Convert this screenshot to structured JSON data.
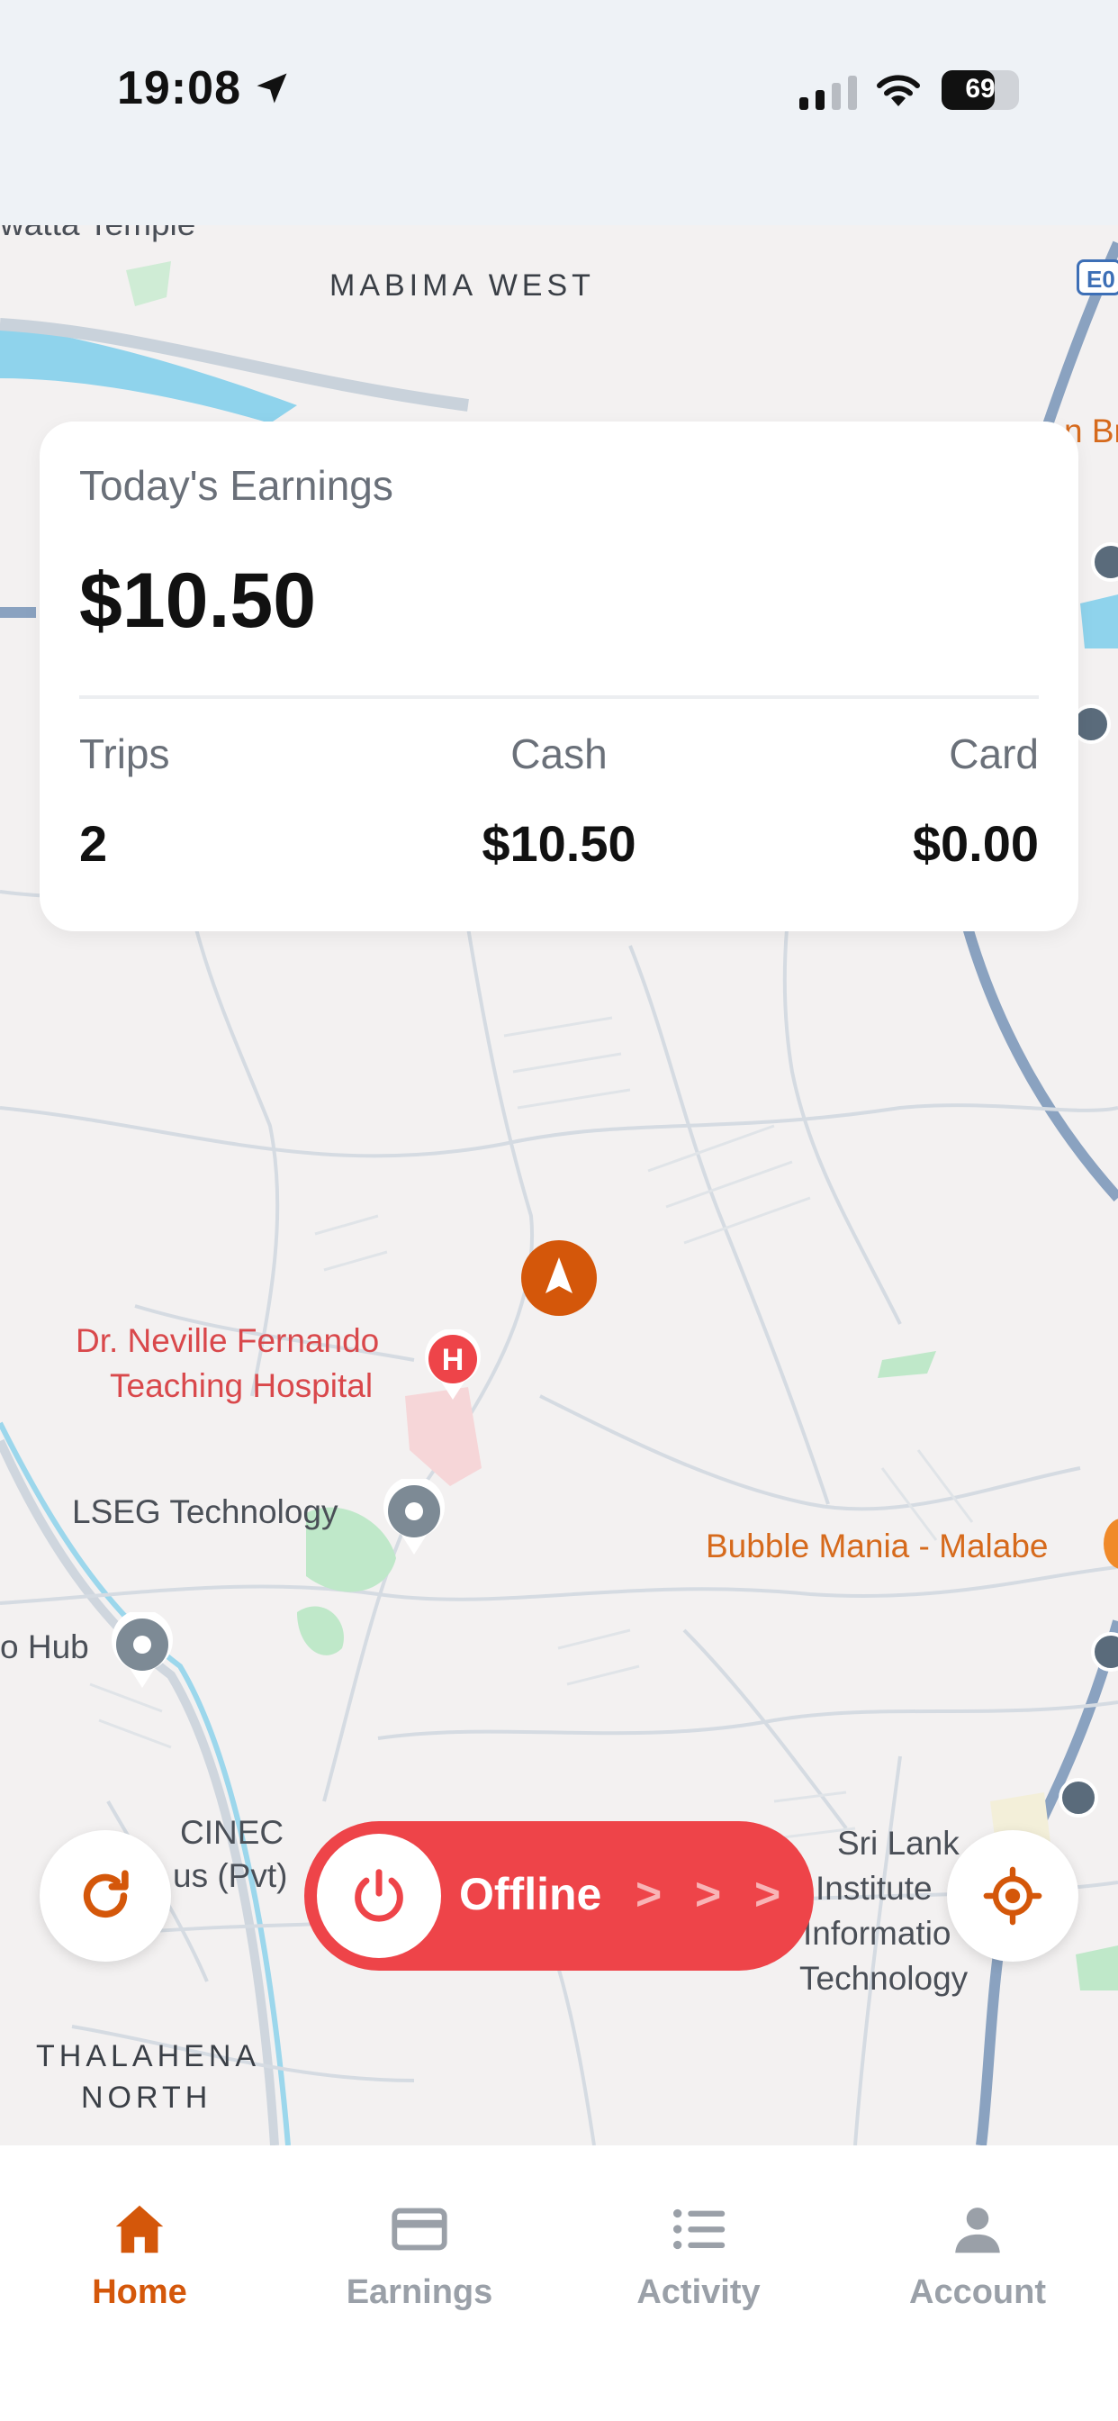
{
  "status_bar": {
    "time": "19:08",
    "battery": "69",
    "battery_level": 0.69
  },
  "map": {
    "labels": {
      "temple": "watta Temple",
      "mabima_west": "MABIMA WEST",
      "road_badge": "E0",
      "top_right": "n Br",
      "hospital_line1": "Dr. Neville Fernando",
      "hospital_line2": "Teaching Hospital",
      "lseg": "LSEG Technology",
      "bubble": "Bubble Mania - Malabe",
      "hub": "o Hub",
      "cinec_line1": "CINEC",
      "cinec_line2": "us (Pvt)",
      "sliit_line1": "Sri Lank",
      "sliit_line2": "Institute",
      "sliit_line3": "Informatio",
      "sliit_line4": "Technology",
      "thalahena_line1": "THALAHENA",
      "thalahena_line2": "NORTH"
    }
  },
  "earnings": {
    "title": "Today's Earnings",
    "amount": "$10.50",
    "trips_label": "Trips",
    "trips_value": "2",
    "cash_label": "Cash",
    "cash_value": "$10.50",
    "card_label": "Card",
    "card_value": "$0.00"
  },
  "controls": {
    "refresh_icon": "refresh-icon",
    "locate_icon": "crosshair-icon",
    "offline_label": "Offline",
    "power_icon": "power-icon",
    "chevrons": [
      ">",
      ">",
      ">"
    ]
  },
  "tabs": [
    {
      "label": "Home",
      "icon": "home-icon",
      "active": true
    },
    {
      "label": "Earnings",
      "icon": "card-icon",
      "active": false
    },
    {
      "label": "Activity",
      "icon": "list-icon",
      "active": false
    },
    {
      "label": "Account",
      "icon": "person-icon",
      "active": false
    }
  ],
  "colors": {
    "accent": "#d4570a",
    "offline": "#ee4449",
    "tab_inactive": "#9aa0a8"
  }
}
